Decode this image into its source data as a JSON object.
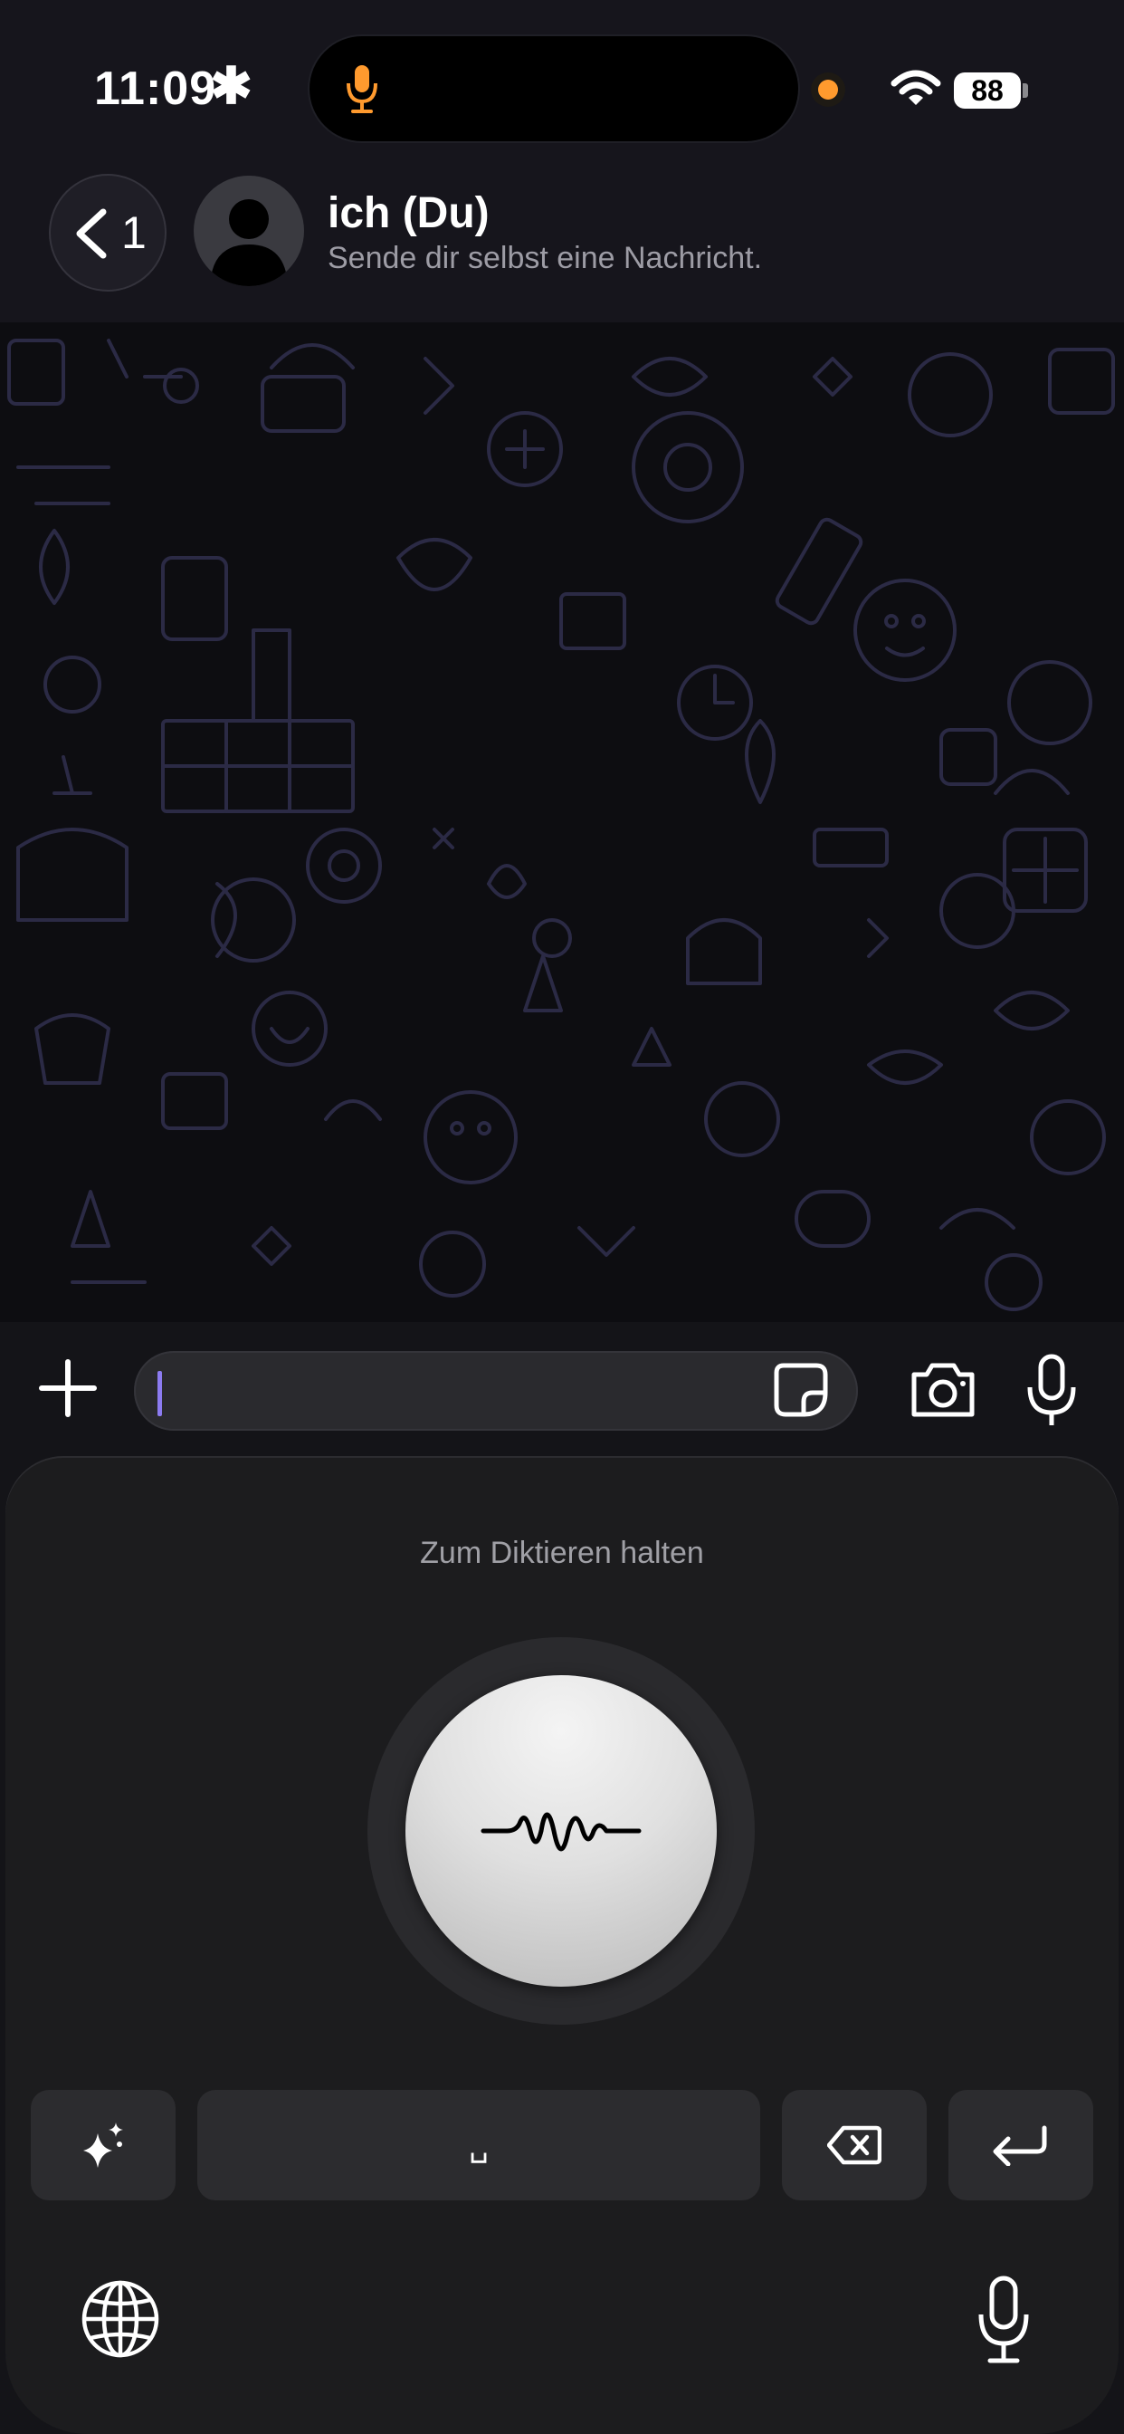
{
  "status_bar": {
    "time": "11:09",
    "time_glyph": "✱",
    "battery": "88"
  },
  "header": {
    "back_count": "1",
    "title": "ich (Du)",
    "subtitle": "Sende dir selbst eine Nachricht."
  },
  "input": {
    "placeholder": "",
    "value": ""
  },
  "keyboard": {
    "hint": "Zum Diktieren halten",
    "space_label": "␣"
  },
  "icons": {
    "island": "microphone-icon",
    "back": "chevron-left-icon",
    "avatar": "person-icon",
    "plus": "plus-icon",
    "sticker": "sticker-icon",
    "camera": "camera-icon",
    "mic": "microphone-icon",
    "sparkle": "sparkles-icon",
    "delete": "delete-icon",
    "return": "return-icon",
    "globe": "globe-icon"
  },
  "colors": {
    "accent_orange": "#ff9a2e",
    "cursor": "#8c7bf0",
    "doodle": "#2b2a45"
  }
}
